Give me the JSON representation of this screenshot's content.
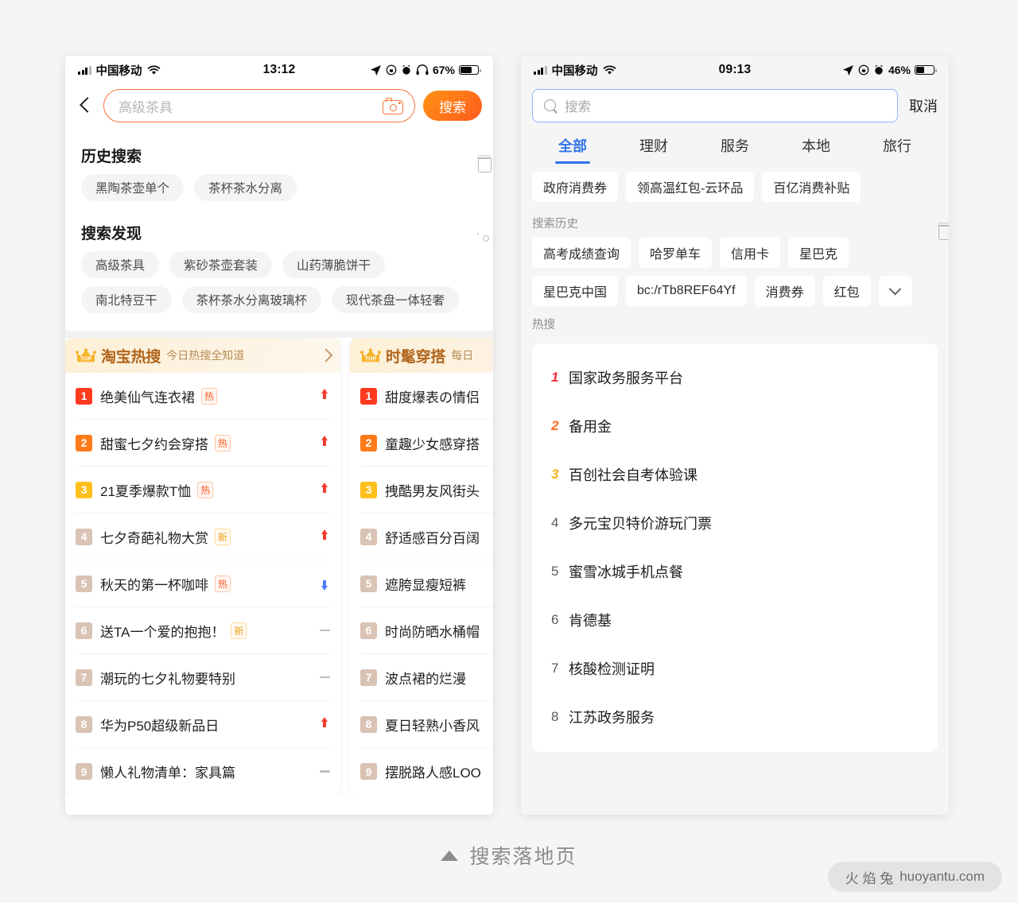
{
  "caption": {
    "text": "搜索落地页",
    "triangle_icon": "triangle-up-icon"
  },
  "watermark": {
    "cn": "火 焰 兔",
    "site": "huoyantu.com"
  },
  "left_phone": {
    "status": {
      "carrier": "中国移动",
      "time": "13:12",
      "battery_pct": "67%",
      "icons": [
        "signal-bars-icon",
        "wifi-icon",
        "location-arrow-icon",
        "rotation-lock-icon",
        "alarm-icon",
        "headphones-icon",
        "battery-icon"
      ]
    },
    "search": {
      "placeholder": "高级茶具",
      "camera_icon": "camera-icon",
      "back_icon": "back-chevron-icon",
      "button": "搜索"
    },
    "history": {
      "title": "历史搜索",
      "clear_icon": "trash-icon",
      "chips": [
        "黑陶茶壶单个",
        "茶杯茶水分离"
      ]
    },
    "discover": {
      "title": "搜索发现",
      "toggle_icon": "eye-icon",
      "chips": [
        "高级茶具",
        "紫砂茶壶套装",
        "山药薄脆饼干",
        "南北特豆干",
        "茶杯茶水分离玻璃杯",
        "现代茶盘一体轻奢"
      ]
    },
    "cards": [
      {
        "crown_icon": "crown-top-icon",
        "title": "淘宝热搜",
        "subtitle": "今日热搜全知道",
        "arrow_icon": "chevron-right-icon",
        "items": [
          {
            "rank": "1",
            "text": "绝美仙气连衣裙",
            "tag": "热",
            "tag_type": "hot",
            "trend": "up"
          },
          {
            "rank": "2",
            "text": "甜蜜七夕约会穿搭",
            "tag": "热",
            "tag_type": "hot",
            "trend": "up"
          },
          {
            "rank": "3",
            "text": "21夏季爆款T恤",
            "tag": "热",
            "tag_type": "hot",
            "trend": "up"
          },
          {
            "rank": "4",
            "text": "七夕奇葩礼物大赏",
            "tag": "新",
            "tag_type": "new",
            "trend": "up"
          },
          {
            "rank": "5",
            "text": "秋天的第一杯咖啡",
            "tag": "热",
            "tag_type": "hot",
            "trend": "down"
          },
          {
            "rank": "6",
            "text": "送TA一个爱的抱抱！",
            "tag": "新",
            "tag_type": "new",
            "trend": "flat"
          },
          {
            "rank": "7",
            "text": "潮玩的七夕礼物要特别",
            "tag": "",
            "tag_type": "",
            "trend": "flat"
          },
          {
            "rank": "8",
            "text": "华为P50超级新品日",
            "tag": "",
            "tag_type": "",
            "trend": "up"
          },
          {
            "rank": "9",
            "text": "懒人礼物清单：家具篇",
            "tag": "",
            "tag_type": "",
            "trend": "flat"
          }
        ]
      },
      {
        "crown_icon": "crown-top-icon",
        "title": "时髦穿搭",
        "subtitle": "每日",
        "arrow_icon": "chevron-right-icon",
        "items": [
          {
            "rank": "1",
            "text": "甜度爆表の情侣",
            "tag": "",
            "tag_type": "",
            "trend": ""
          },
          {
            "rank": "2",
            "text": "童趣少女感穿搭",
            "tag": "",
            "tag_type": "",
            "trend": ""
          },
          {
            "rank": "3",
            "text": "拽酷男友风街头",
            "tag": "",
            "tag_type": "",
            "trend": ""
          },
          {
            "rank": "4",
            "text": "舒适感百分百阔",
            "tag": "",
            "tag_type": "",
            "trend": ""
          },
          {
            "rank": "5",
            "text": "遮胯显瘦短裤",
            "tag": "",
            "tag_type": "",
            "trend": ""
          },
          {
            "rank": "6",
            "text": "时尚防晒水桶帽",
            "tag": "",
            "tag_type": "",
            "trend": ""
          },
          {
            "rank": "7",
            "text": "波点裙的烂漫",
            "tag": "",
            "tag_type": "",
            "trend": ""
          },
          {
            "rank": "8",
            "text": "夏日轻熟小香风",
            "tag": "",
            "tag_type": "",
            "trend": ""
          },
          {
            "rank": "9",
            "text": "摆脱路人感LOO",
            "tag": "",
            "tag_type": "",
            "trend": ""
          }
        ]
      }
    ]
  },
  "right_phone": {
    "status": {
      "carrier": "中国移动",
      "time": "09:13",
      "battery_pct": "46%",
      "icons": [
        "signal-bars-icon",
        "wifi-icon",
        "location-arrow-icon",
        "rotation-lock-icon",
        "alarm-icon",
        "battery-icon"
      ]
    },
    "search": {
      "placeholder": "搜索",
      "search_icon": "magnifier-icon",
      "cancel": "取消"
    },
    "tabs": [
      {
        "label": "全部",
        "active": true
      },
      {
        "label": "理财",
        "active": false
      },
      {
        "label": "服务",
        "active": false
      },
      {
        "label": "本地",
        "active": false
      },
      {
        "label": "旅行",
        "active": false
      }
    ],
    "promos": [
      "政府消费券",
      "领高温红包-云环品",
      "百亿消费补贴"
    ],
    "history": {
      "title": "搜索历史",
      "clear_icon": "trash-icon",
      "chips": [
        "高考成绩查询",
        "哈罗单车",
        "信用卡",
        "星巴克",
        "星巴克中国",
        "bc:/rTb8REF64Yf",
        "消费券",
        "红包"
      ],
      "expand_icon": "chevron-down-icon"
    },
    "hot": {
      "title": "热搜",
      "items": [
        {
          "rank": "1",
          "text": "国家政务服务平台"
        },
        {
          "rank": "2",
          "text": "备用金"
        },
        {
          "rank": "3",
          "text": "百创社会自考体验课"
        },
        {
          "rank": "4",
          "text": "多元宝贝特价游玩门票"
        },
        {
          "rank": "5",
          "text": "蜜雪冰城手机点餐"
        },
        {
          "rank": "6",
          "text": "肯德基"
        },
        {
          "rank": "7",
          "text": "核酸检测证明"
        },
        {
          "rank": "8",
          "text": "江苏政务服务"
        }
      ]
    }
  }
}
